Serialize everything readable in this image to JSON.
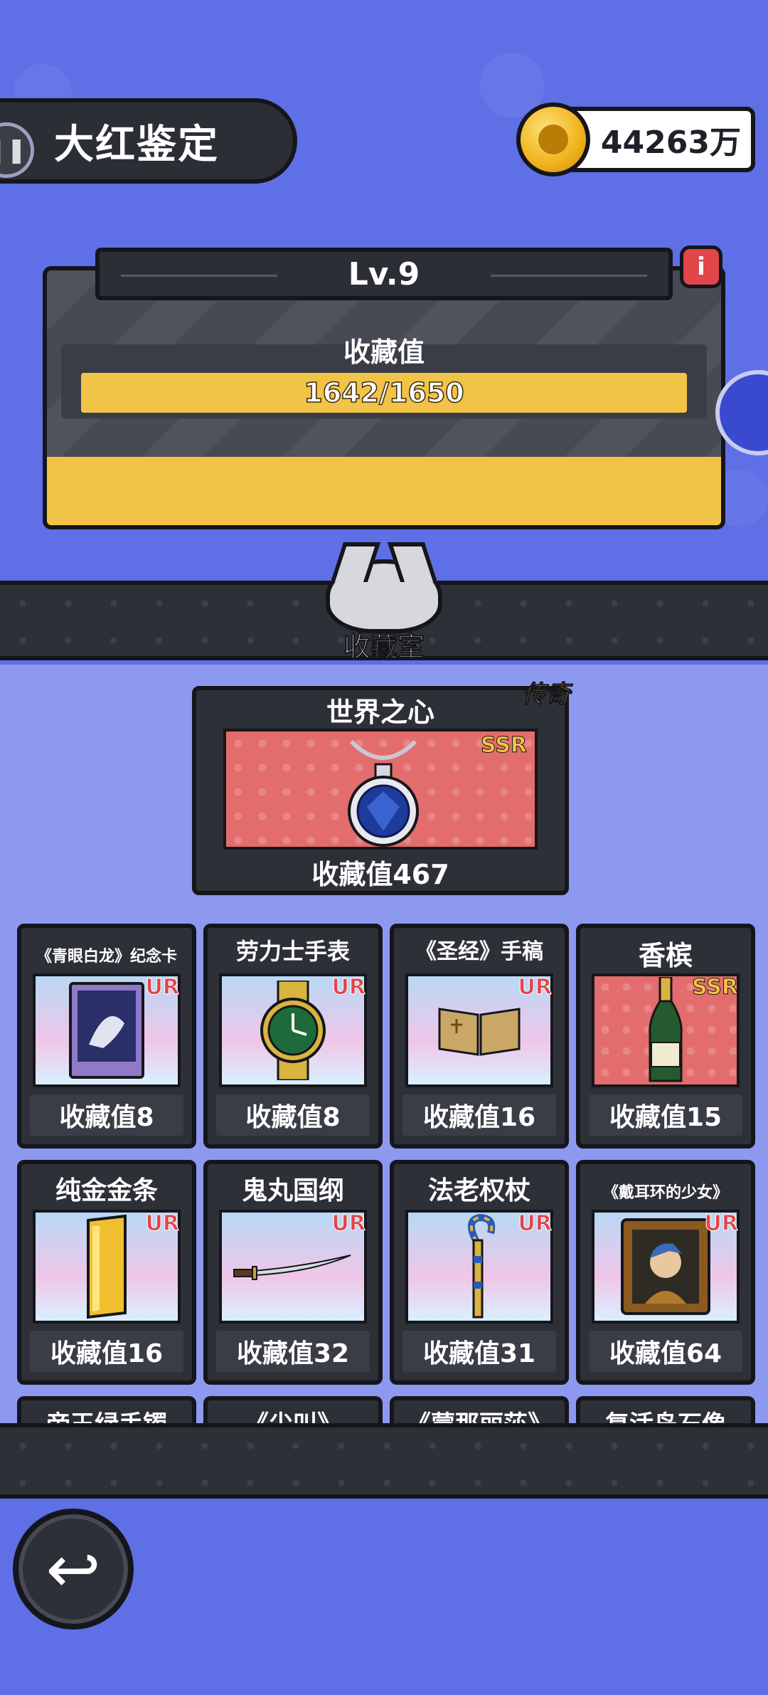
{
  "header": {
    "title": "大红鉴定",
    "coins": "44263万"
  },
  "level": {
    "label": "Lv.9",
    "collect_label": "收藏值",
    "progress_text": "1642/1650",
    "progress_current": 1642,
    "progress_max": 1650
  },
  "room": {
    "label": "收藏室"
  },
  "featured": {
    "tag": "传奇",
    "name": "世界之心",
    "rarity": "SSR",
    "value": "收藏值467"
  },
  "items": [
    {
      "name": "《青眼白龙》纪念卡",
      "rarity": "UR",
      "value": "收藏值8",
      "icon": "dragon-card-icon"
    },
    {
      "name": "劳力士手表",
      "rarity": "UR",
      "value": "收藏值8",
      "icon": "watch-icon"
    },
    {
      "name": "《圣经》手稿",
      "rarity": "UR",
      "value": "收藏值16",
      "icon": "book-icon"
    },
    {
      "name": "香槟",
      "rarity": "SSR",
      "value": "收藏值15",
      "icon": "champagne-icon"
    },
    {
      "name": "纯金金条",
      "rarity": "UR",
      "value": "收藏值16",
      "icon": "gold-bar-icon"
    },
    {
      "name": "鬼丸国纲",
      "rarity": "UR",
      "value": "收藏值32",
      "icon": "katana-icon"
    },
    {
      "name": "法老权杖",
      "rarity": "UR",
      "value": "收藏值31",
      "icon": "scepter-icon"
    },
    {
      "name": "《戴耳环的少女》",
      "rarity": "UR",
      "value": "收藏值64",
      "icon": "painting-icon"
    }
  ],
  "partial_items": [
    "帝王绿手镯",
    "《尖叫》",
    "《蒙那丽莎》",
    "复活岛石像"
  ],
  "colors": {
    "background": "#5f6fe6",
    "panel": "#2e3038",
    "gold": "#f1c347",
    "ur_red": "#e2454a"
  }
}
